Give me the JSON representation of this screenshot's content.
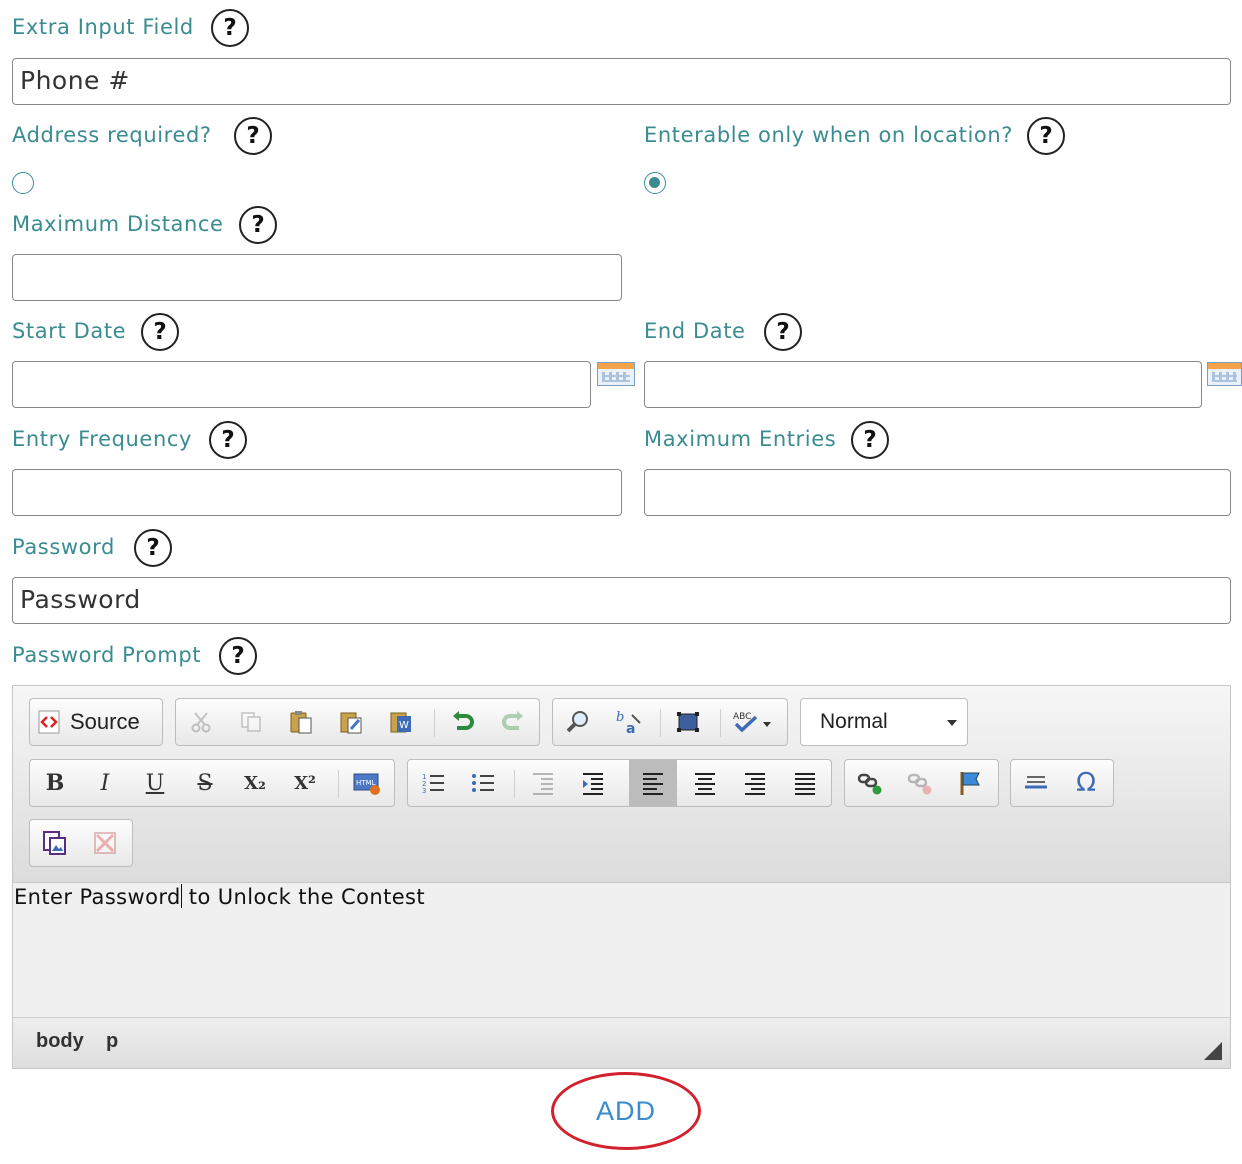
{
  "fields": {
    "extra_input": {
      "label": "Extra Input Field",
      "value": "Phone #"
    },
    "address_required": {
      "label": "Address required?",
      "selected": false
    },
    "enterable_on_location": {
      "label": "Enterable only when on location?",
      "selected": true
    },
    "max_distance": {
      "label": "Maximum Distance",
      "value": ""
    },
    "start_date": {
      "label": "Start Date",
      "value": ""
    },
    "end_date": {
      "label": "End Date",
      "value": ""
    },
    "entry_frequency": {
      "label": "Entry Frequency",
      "value": ""
    },
    "max_entries": {
      "label": "Maximum Entries",
      "value": ""
    },
    "password": {
      "label": "Password",
      "value": "Password"
    },
    "password_prompt": {
      "label": "Password Prompt"
    }
  },
  "help_glyph": "?",
  "editor": {
    "source_label": "Source",
    "format_value": "Normal",
    "content_before_caret": "Enter Password",
    "content_after_caret": " to Unlock the Contest",
    "path": [
      "body",
      "p"
    ],
    "buttons": {
      "bold": "B",
      "italic": "I",
      "underline": "U",
      "strike": "S",
      "subscript": "X₂",
      "superscript": "X²",
      "special_char": "Ω"
    }
  },
  "add_label": "ADD",
  "colors": {
    "label": "#3a8c91",
    "add": "#3a8ccf",
    "highlight_ring": "#d2202f"
  }
}
